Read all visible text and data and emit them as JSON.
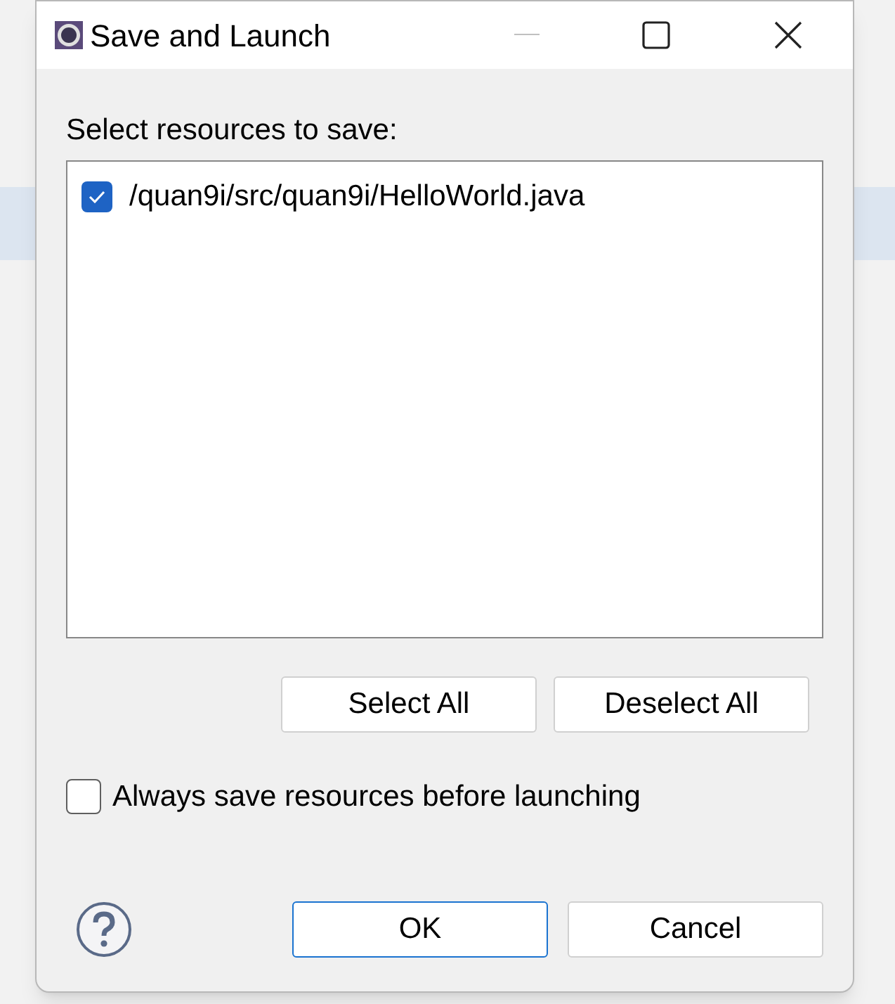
{
  "window": {
    "title": "Save and Launch"
  },
  "prompt": "Select resources to save:",
  "resources": [
    {
      "path": "/quan9i/src/quan9i/HelloWorld.java",
      "checked": true
    }
  ],
  "selection_buttons": [
    "Select All",
    "Deselect All"
  ],
  "always_save": {
    "label": "Always save resources before launching",
    "checked": false
  },
  "buttons": [
    {
      "label": "OK",
      "default": true
    },
    {
      "label": "Cancel",
      "default": false
    }
  ]
}
